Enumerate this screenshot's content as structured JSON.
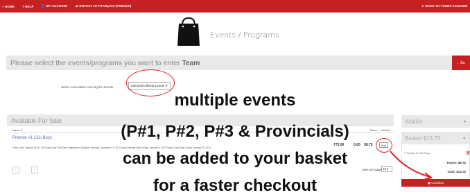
{
  "topnav": {
    "home": "≡ HOME",
    "help": "? HELP",
    "account": "👤 MY ACCOUNT",
    "french": "⇄ SWITCH TO FRANÇAIS (FRENCH)",
    "back": "⇤ BACK TO YOURS ACCOUNT"
  },
  "header": {
    "title": "Events / Programs"
  },
  "selection": {
    "prompt": "Please select the events/programs you want to enter",
    "team": "Team",
    "next_button": "← Ba",
    "assoc_label": "Select Association running the Events",
    "assoc_value": "Volleyball Alberta Events"
  },
  "sale": {
    "heading": "Available For Sale",
    "col_name": "Name ⇕",
    "col_taxes": "Taxes",
    "col_actions": "Actions",
    "row": {
      "title": "Premier #1 15U Boys",
      "dates": "Event Date: January 28-29, 2023  Main Day: Red Deer  Registration Deadline: Monday, December 19, 2022  Draw Release Date: Friday, January 6, 2023  Roster Lock Date: Friday, January 20, 2023",
      "price": "775.00",
      "fee": "0.00",
      "total": "38.75",
      "buy": "Buy"
    },
    "prev": "‹",
    "next": "›",
    "rows_label": "rows per page",
    "rows_value": "15 ▾"
  },
  "waitlist": {
    "heading": "Waitlist",
    "chevron": "▾"
  },
  "basket": {
    "heading": "Basket $13.75",
    "chevron": "▾",
    "item": "1. Premier #1 15U Boys",
    "remove": "🗑",
    "teams": "Teams: $8.75",
    "total": "Total: $13.75",
    "continue": "▣ Continue"
  },
  "annotation": {
    "line1": "multiple events",
    "line2": "(P#1, P#2, P#3 & Provincials)",
    "line3": "can be added to your basket",
    "line4": "for a faster checkout"
  },
  "colors": {
    "brand_red": "#c62023",
    "annotation_red": "#e02020"
  }
}
